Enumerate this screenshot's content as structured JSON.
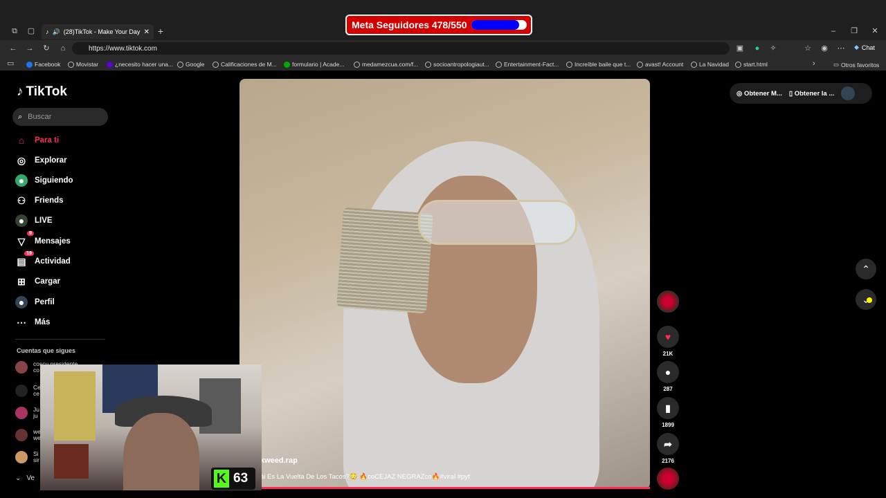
{
  "browser": {
    "tab_title": "(28)TikTok - Make Your Day",
    "new_tab": "+",
    "url": "https://www.tiktok.com",
    "chat_label": "Chat",
    "bookmarks": [
      "Facebook",
      "Movistar",
      "¿necesito hacer una...",
      "Google",
      "Calificaciones de M...",
      "formulario | Acade...",
      "medamezcua.com/f...",
      "socioantropologiaut...",
      "Entertainment-Fact...",
      "Increíble baile que t...",
      "avast! Account",
      "La Navidad",
      "start.html"
    ],
    "other_favorites": "Otros favoritos"
  },
  "goal": {
    "label": "Meta Seguidores 478/550",
    "current": 478,
    "target": 550
  },
  "sidebar": {
    "logo": "TikTok",
    "search_placeholder": "Buscar",
    "items": [
      {
        "label": "Para ti",
        "icon": "home-icon",
        "active": true
      },
      {
        "label": "Explorar",
        "icon": "compass-icon"
      },
      {
        "label": "Siguiendo",
        "icon": "following-icon"
      },
      {
        "label": "Friends",
        "icon": "friends-icon"
      },
      {
        "label": "LIVE",
        "icon": "live-icon"
      },
      {
        "label": "Mensajes",
        "icon": "messages-icon",
        "badge": "9"
      },
      {
        "label": "Actividad",
        "icon": "activity-icon",
        "badge": "19"
      },
      {
        "label": "Cargar",
        "icon": "upload-icon"
      },
      {
        "label": "Perfil",
        "icon": "profile-icon"
      },
      {
        "label": "Más",
        "icon": "more-icon"
      }
    ],
    "following_header": "Cuentas que sigues",
    "following": [
      {
        "name": "coscu presidente",
        "sub": "co"
      },
      {
        "name": "Ce",
        "sub": "ce"
      },
      {
        "name": "Ju",
        "sub": "ju"
      },
      {
        "name": "we",
        "sub": "we"
      },
      {
        "name": "Si",
        "sub": "sir"
      }
    ],
    "see_more": "Ve"
  },
  "video": {
    "username": "kweed.rap",
    "caption": "ái Es La Vuelta De Los Tacos?😳 🔥coCEJAZ NEGRAZco🔥#viral #pyf",
    "likes": "21K",
    "comments": "287",
    "saves": "1899",
    "shares": "2176"
  },
  "topbar": {
    "get_coins": "Obtener M...",
    "get_app": "Obtener la ..."
  },
  "overlay": {
    "kick_count": "63"
  },
  "colors": {
    "accent": "#fe2c55",
    "goal_bg": "#d40000",
    "goal_fill": "#0000ff",
    "kick_green": "#53fc18"
  }
}
